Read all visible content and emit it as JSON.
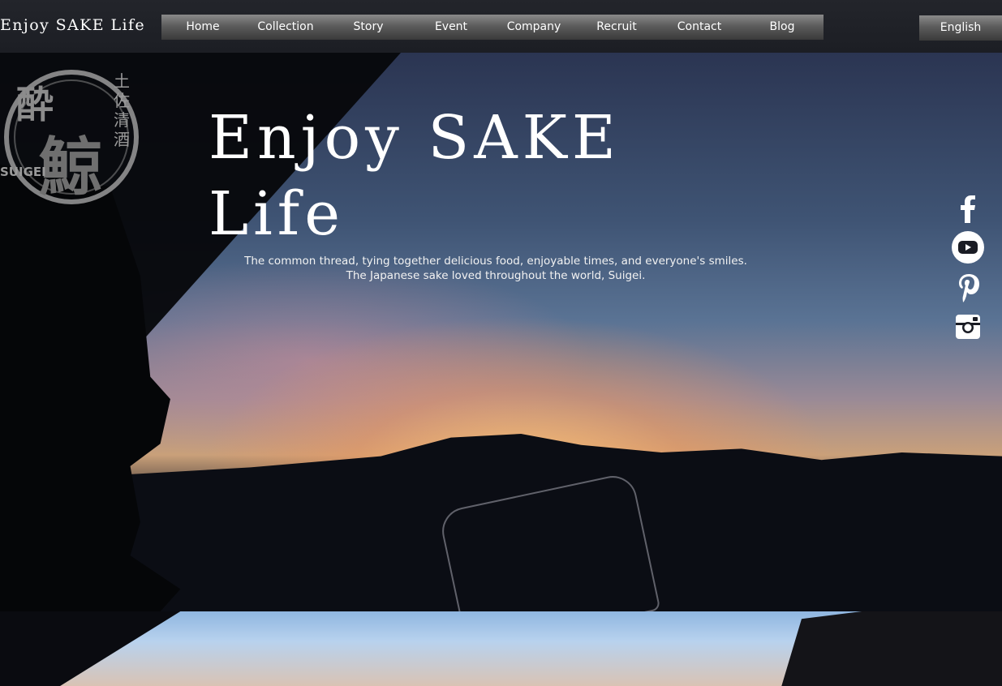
{
  "header": {
    "site_title": "Enjoy SAKE Life",
    "nav": [
      {
        "label": "Home"
      },
      {
        "label": "Collection"
      },
      {
        "label": "Story"
      },
      {
        "label": "Event"
      },
      {
        "label": "Company"
      },
      {
        "label": "Recruit"
      },
      {
        "label": "Contact"
      },
      {
        "label": "Blog"
      }
    ],
    "language": "English"
  },
  "hero": {
    "title_line1": "Enjoy SAKE",
    "title_line2": "Life",
    "tagline_line1": "The common thread, tying together delicious food, enjoyable times, and everyone's smiles.",
    "tagline_line2": "The Japanese sake loved throughout the world, Suigei.",
    "logo_icon": "suigei-logo-icon"
  },
  "social": [
    {
      "icon": "facebook-icon"
    },
    {
      "icon": "youtube-icon"
    },
    {
      "icon": "pinterest-icon"
    },
    {
      "icon": "instagram-icon"
    }
  ],
  "colors": {
    "header_bg": "#1c1e24",
    "nav_bg": "#5c5c5c",
    "text": "#ffffff"
  }
}
